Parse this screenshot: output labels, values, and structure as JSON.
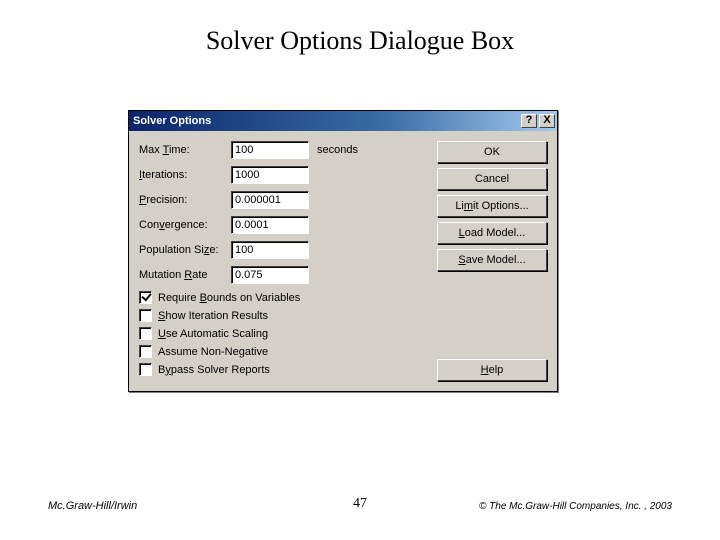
{
  "slide": {
    "title": "Solver Options Dialogue Box",
    "page_number": "47",
    "footer_left": "Mc.Graw-Hill/Irwin",
    "footer_right": "© The Mc.Graw-Hill Companies, Inc. , 2003"
  },
  "dialog": {
    "title": "Solver Options",
    "help_glyph": "?",
    "close_glyph": "X",
    "fields": {
      "max_time": {
        "label_pre": "Max ",
        "label_u": "T",
        "label_post": "ime:",
        "value": "100",
        "unit": "seconds"
      },
      "iterations": {
        "label_u": "I",
        "label_post": "terations:",
        "value": "1000"
      },
      "precision": {
        "label_u": "P",
        "label_post": "recision:",
        "value": "0.000001"
      },
      "convergence": {
        "label_pre": "Con",
        "label_u": "v",
        "label_post": "ergence:",
        "value": "0.0001"
      },
      "population": {
        "label_pre": "Population Si",
        "label_u": "z",
        "label_post": "e:",
        "value": "100"
      },
      "mutation": {
        "label_pre": "Mutation ",
        "label_u": "R",
        "label_post": "ate",
        "value": "0.075"
      }
    },
    "checkboxes": {
      "require_bounds": {
        "checked": true,
        "pre": "Require ",
        "u": "B",
        "post": "ounds on Variables"
      },
      "show_iter": {
        "checked": false,
        "pre": "",
        "u": "S",
        "post": "how Iteration Results"
      },
      "auto_scale": {
        "checked": false,
        "pre": "",
        "u": "U",
        "post": "se Automatic Scaling"
      },
      "non_negative": {
        "checked": false,
        "pre": "Assume Non-Ne",
        "u": "g",
        "post": "ative"
      },
      "bypass": {
        "checked": false,
        "pre": "B",
        "u": "y",
        "post": "pass Solver Reports"
      }
    },
    "buttons": {
      "ok": "OK",
      "cancel": "Cancel",
      "limit_pre": "Li",
      "limit_u": "m",
      "limit_post": "it Options...",
      "load_u": "L",
      "load_post": "oad Model...",
      "save_u": "S",
      "save_post": "ave Model...",
      "help_u": "H",
      "help_post": "elp"
    }
  }
}
